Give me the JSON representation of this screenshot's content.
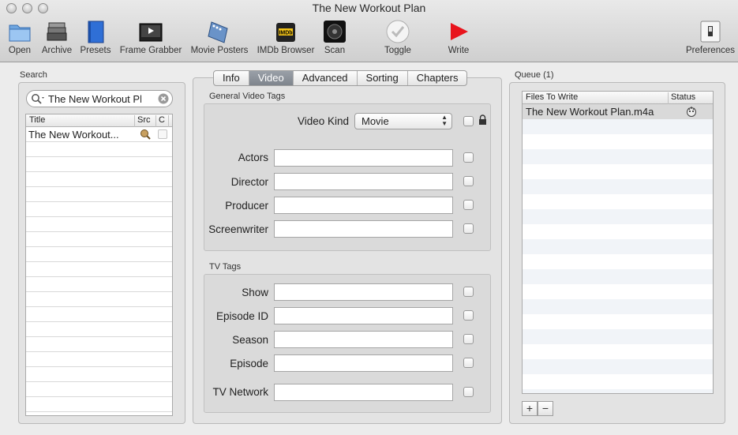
{
  "window": {
    "title": "The New Workout Plan"
  },
  "toolbar": {
    "items": [
      {
        "label": "Open",
        "icon": "folder-icon"
      },
      {
        "label": "Archive",
        "icon": "archive-icon"
      },
      {
        "label": "Presets",
        "icon": "book-icon"
      },
      {
        "label": "Frame Grabber",
        "icon": "film-frame-icon"
      },
      {
        "label": "Movie Posters",
        "icon": "film-strip-icon"
      },
      {
        "label": "IMDb Browser",
        "icon": "imdb-icon"
      },
      {
        "label": "Scan",
        "icon": "scan-icon"
      },
      {
        "label": "Toggle",
        "icon": "toggle-check-icon"
      },
      {
        "label": "Write",
        "icon": "play-arrow-icon"
      },
      {
        "label": "Preferences",
        "icon": "switch-icon"
      }
    ],
    "write_color": "#e8141c"
  },
  "search": {
    "section_label": "Search",
    "value": "The New Workout Pla",
    "value_faded": "n"
  },
  "results": {
    "columns": [
      "Title",
      "Src",
      "C"
    ],
    "rows": [
      {
        "title": "The New Workout..."
      }
    ]
  },
  "tabs": {
    "items": [
      "Info",
      "Video",
      "Advanced",
      "Sorting",
      "Chapters"
    ],
    "selected": "Video"
  },
  "general": {
    "title": "General Video Tags",
    "video_kind_label": "Video Kind",
    "video_kind_value": "Movie",
    "actors_label": "Actors",
    "director_label": "Director",
    "producer_label": "Producer",
    "screenwriter_label": "Screenwriter"
  },
  "tv": {
    "title": "TV Tags",
    "show_label": "Show",
    "episode_id_label": "Episode ID",
    "season_label": "Season",
    "episode_label": "Episode",
    "network_label": "TV Network"
  },
  "queue": {
    "section_label": "Queue (1)",
    "columns": [
      "Files To Write",
      "Status"
    ],
    "rows": [
      {
        "file": "The New Workout Plan.m4a"
      }
    ],
    "add_label": "+",
    "remove_label": "−"
  }
}
